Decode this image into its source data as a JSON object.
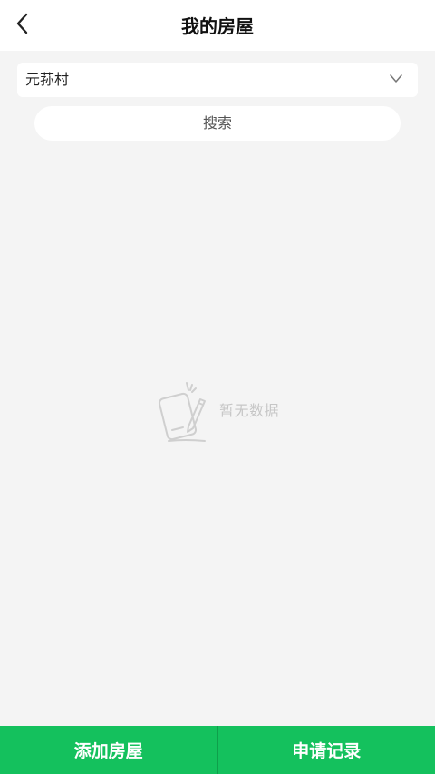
{
  "header": {
    "title": "我的房屋",
    "back_icon": "chevron-left-icon"
  },
  "filter": {
    "selected_village": "元荪村",
    "dropdown_icon": "chevron-down-icon",
    "search_label": "搜索"
  },
  "empty_state": {
    "icon": "empty-document-icon",
    "text": "暂无数据"
  },
  "bottom_bar": {
    "add_label": "添加房屋",
    "records_label": "申请记录"
  },
  "colors": {
    "accent": "#14c15d",
    "background": "#f4f4f4",
    "empty_text": "#c6c6c6"
  }
}
